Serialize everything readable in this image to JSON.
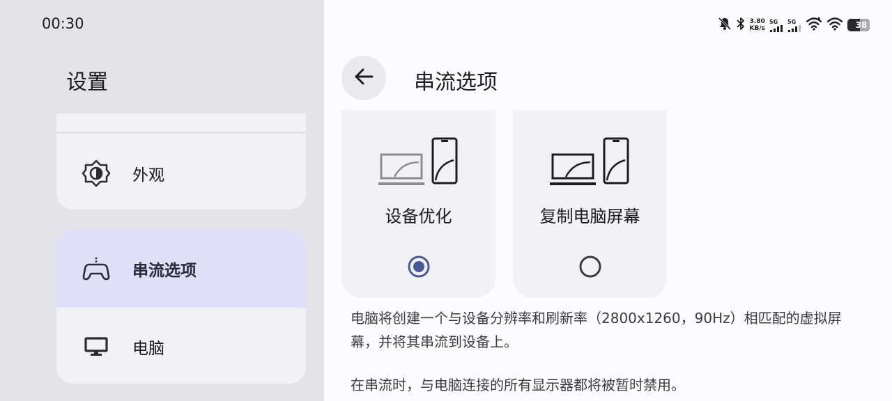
{
  "status_bar": {
    "time": "00:30",
    "net_speed_value": "3.80",
    "net_speed_unit": "KB/s",
    "signal_1_tag": "5G",
    "signal_2_tag": "5G",
    "battery": "38",
    "icons": [
      "bell-off-icon",
      "bluetooth-icon",
      "signal-icon",
      "signal-icon",
      "wifi-icon",
      "wifi-icon",
      "battery-icon"
    ]
  },
  "sidebar": {
    "title": "设置",
    "items": [
      {
        "label": "外观",
        "icon": "appearance-icon"
      },
      {
        "label": "串流选项",
        "icon": "gamepad-icon",
        "selected": true
      },
      {
        "label": "电脑",
        "icon": "monitor-icon"
      }
    ]
  },
  "page": {
    "title": "串流选项",
    "back_icon": "arrow-left-icon"
  },
  "options": [
    {
      "label": "设备优化",
      "selected": true
    },
    {
      "label": "复制电脑屏幕",
      "selected": false
    }
  ],
  "description": {
    "para1": "电脑将创建一个与设备分辨率和刷新率（2800x1260，90Hz）相匹配的虚拟屏幕，并将其串流到设备上。",
    "para2": "在串流时，与电脑连接的所有显示器都将被暂时禁用。"
  },
  "colors": {
    "accent": "#4a5896",
    "left_background": "#e5e3ea",
    "selected_row": "#dfdff7",
    "card": "#f2f1f6"
  }
}
